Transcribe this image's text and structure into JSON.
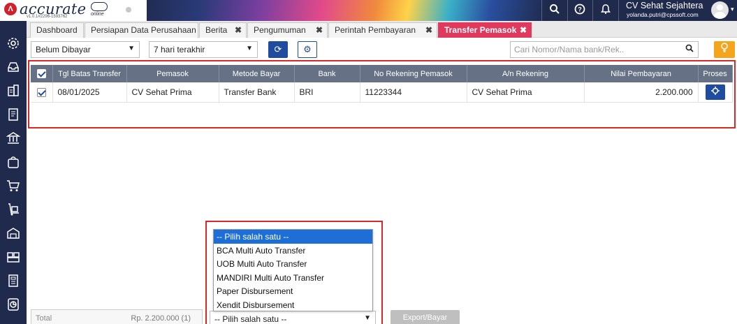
{
  "app": {
    "logo_text": "accurate",
    "logo_sub": "online",
    "version": "v1.0.1#2296-1593762",
    "company": "CV Sehat Sejahtera",
    "email": "yolanda.putri@cpssoft.com"
  },
  "tabs": [
    {
      "label": "Dashboard",
      "closable": false
    },
    {
      "label": "Persiapan Data Perusahaan",
      "closable": false
    },
    {
      "label": "Berita",
      "closable": true
    },
    {
      "label": "Pengumuman",
      "closable": true
    },
    {
      "label": "Perintah Pembayaran",
      "closable": true
    },
    {
      "label": "Transfer Pemasok",
      "closable": true,
      "active": true
    }
  ],
  "tab_count": "6",
  "toolbar": {
    "status_filter": "Belum Dibayar",
    "period_filter": "7 hari terakhir",
    "search_placeholder": "Cari Nomor/Nama bank/Rek..",
    "refresh_icon": "refresh-icon",
    "settings_icon": "gear-icon",
    "tip_icon": "lightbulb-icon"
  },
  "table": {
    "columns": [
      "Tgl Batas Transfer",
      "Pemasok",
      "Metode Bayar",
      "Bank",
      "No Rekening Pemasok",
      "A/n Rekening",
      "Nilai Pembayaran",
      "Proses"
    ],
    "rows": [
      {
        "checked": true,
        "tgl": "08/01/2025",
        "pemasok": "CV Sehat Prima",
        "metode": "Transfer Bank",
        "bank": "BRI",
        "no_rek": "11223344",
        "an_rek": "CV Sehat Prima",
        "nilai": "2.200.000"
      }
    ]
  },
  "footer": {
    "total_label": "Total",
    "total_value": "Rp. 2.200.000 (1)",
    "method_select": "-- Pilih salah satu --",
    "export_label": "Export/Bayar"
  },
  "dropdown": {
    "options": [
      "-- Pilih salah satu --",
      "BCA Multi Auto Transfer",
      "UOB Multi Auto Transfer",
      "MANDIRI Multi Auto Transfer",
      "Paper Disbursement",
      "Xendit Disbursement"
    ],
    "selected_index": 0
  },
  "colors": {
    "nav": "#1f2a4d",
    "accent_tab": "#e0395d",
    "primary": "#1f4c9e",
    "highlight_frame": "#d62a2a",
    "table_header": "#667185"
  }
}
